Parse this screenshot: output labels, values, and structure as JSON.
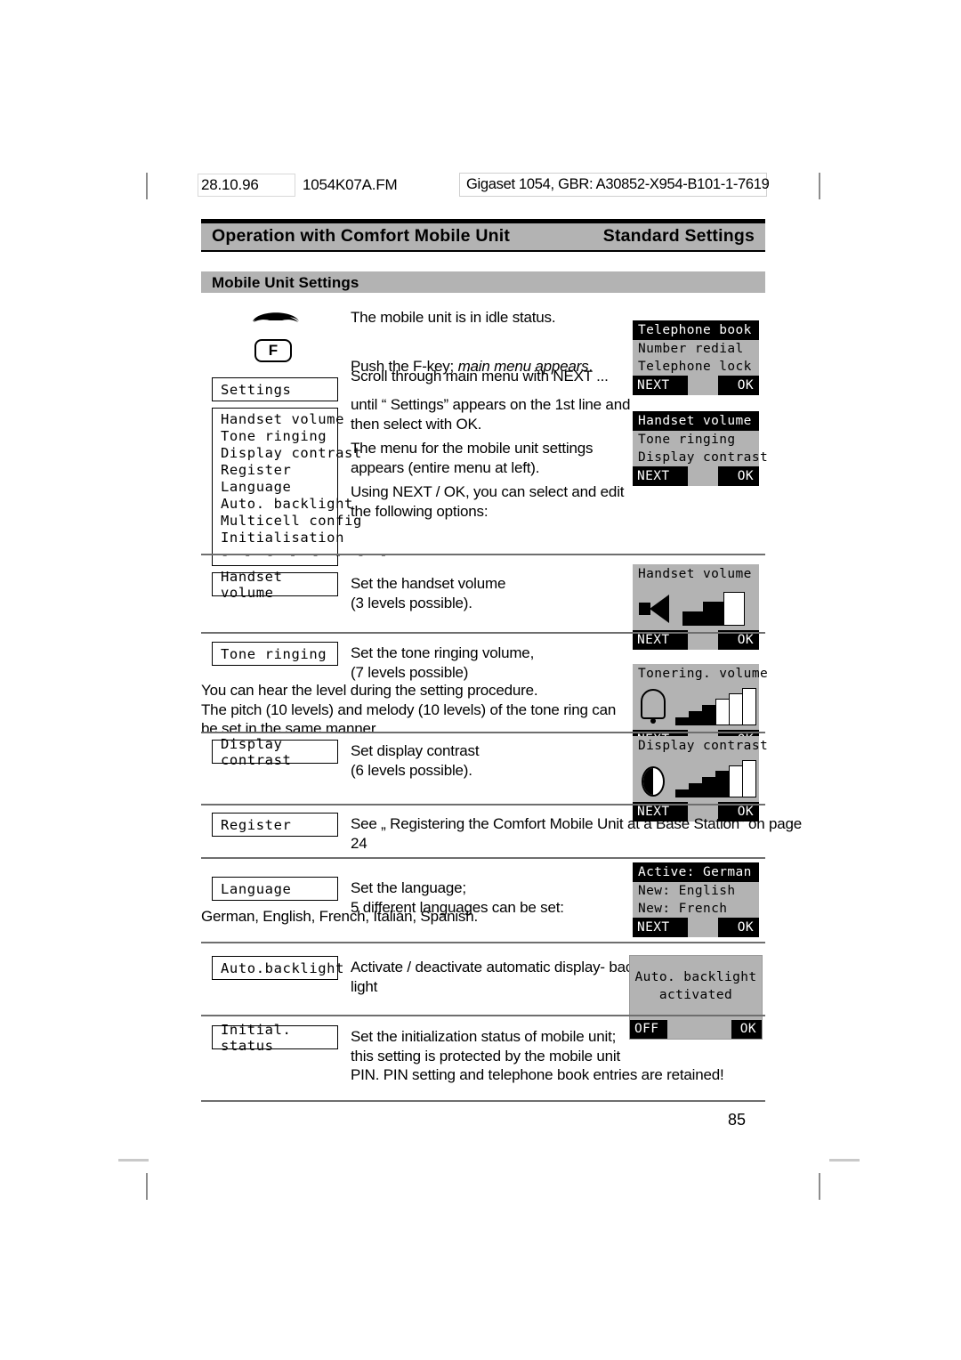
{
  "meta": {
    "date": "28.10.96",
    "filename": "1054K07A.FM",
    "document_id": "Gigaset 1054, GBR: A30852-X954-B101-1-7619"
  },
  "running_head": {
    "left": "Operation with Comfort Mobile Unit",
    "right": "Standard Settings"
  },
  "section_band": "Mobile Unit Settings",
  "page_number": "85",
  "icons": {
    "handset": "handset-idle-icon",
    "fkey_label": "F"
  },
  "intro": {
    "line1": "The mobile unit is in idle status.",
    "line2_a": "Push the F-key; ",
    "line2_b": "main menu appears",
    "line2_c": ".",
    "line3": "Scroll through main menu with NEXT ...",
    "para1": "until “ Settings”  appears on the 1st line and\nthen select with OK.",
    "para2": "The menu for the mobile unit settings\nappears (entire menu at left).",
    "para3": "Using NEXT / OK, you can select and edit\nthe following options:"
  },
  "settings_label": "Settings",
  "menu_list": {
    "items": [
      "Handset volume",
      "Tone ringing",
      "Display contrast",
      "Register",
      "Language",
      "Auto. backlight",
      "Multicell config",
      "Initialisation"
    ],
    "scroll_dashes": "- - - - - - - -"
  },
  "displays": {
    "main_menu": {
      "title": "Telephone book",
      "lines": [
        "Number redial",
        "Telephone lock"
      ],
      "softkey_left": "NEXT",
      "softkey_right": "OK"
    },
    "settings_menu": {
      "title": "Handset volume",
      "lines": [
        "Tone ringing",
        "Display contrast"
      ],
      "softkey_left": "NEXT",
      "softkey_right": "OK"
    },
    "handset_volume": {
      "title": "Handset volume",
      "icon": "speaker-icon",
      "levels_total": 3,
      "levels_filled": 2,
      "softkey_left": "NEXT",
      "softkey_right": "OK"
    },
    "tone_ringing": {
      "title": "Tonering. volume",
      "icon": "bell-icon",
      "levels_total": 6,
      "levels_filled": 3,
      "softkey_left": "NEXT",
      "softkey_right": "OK"
    },
    "display_contrast": {
      "title": "Display contrast",
      "icon": "contrast-circle-icon",
      "levels_total": 6,
      "levels_filled": 4,
      "softkey_left": "NEXT",
      "softkey_right": "OK"
    },
    "language": {
      "title": "Active: German",
      "lines": [
        "New: English",
        "New: French"
      ],
      "softkey_left": "NEXT",
      "softkey_right": "OK"
    },
    "auto_backlight": {
      "line1": "Auto. backlight",
      "line2": "activated",
      "softkey_left": "OFF",
      "softkey_right": "OK"
    }
  },
  "rows": [
    {
      "label": "Handset volume",
      "text": "Set the handset volume\n(3 levels possible)."
    },
    {
      "label": "Tone ringing",
      "text": "Set the tone ringing volume,\n(7 levels possible)",
      "note": "You can hear the level during the setting procedure.\nThe pitch (10 levels) and melody (10 levels) of the tone ring can\nbe set in the same manner."
    },
    {
      "label": "Display contrast",
      "text": "Set display contrast\n(6 levels possible)."
    },
    {
      "label": "Register",
      "text": "See „ Registering the Comfort Mobile Unit at a Base Station“  on page\n24"
    },
    {
      "label": "Language",
      "text": "Set the language;\n5 different languages can be set:",
      "note": "German, English, French, Italian, Spanish."
    },
    {
      "label": "Auto.backlight",
      "text": "Activate / deactivate automatic display- back-\nlight"
    },
    {
      "label": "Initial. status",
      "text": "Set the initialization status of mobile unit;\nthis setting is protected by the mobile unit\nPIN. PIN setting and telephone book entries are retained!"
    }
  ]
}
